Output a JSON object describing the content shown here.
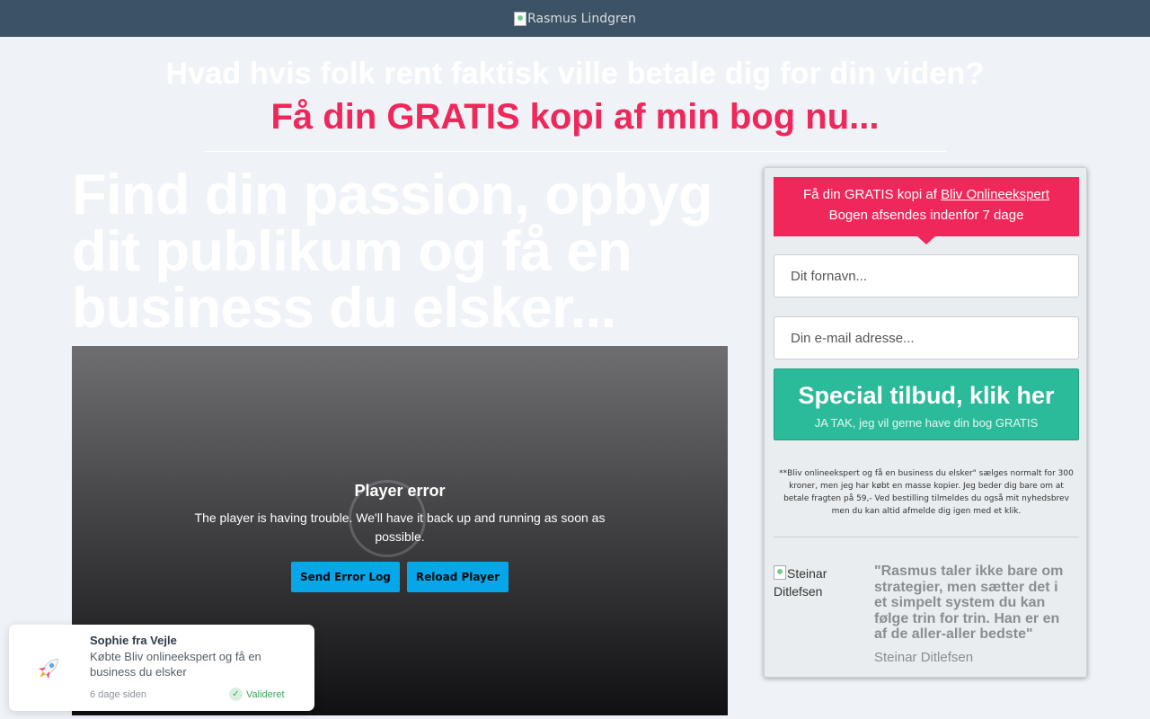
{
  "header": {
    "logo_alt": "Rasmus Lindgren"
  },
  "headline": {
    "question": "Hvad hvis folk rent faktisk ville betale dig for din viden?",
    "offer": "Få din GRATIS kopi af min bog nu..."
  },
  "hero_title": "Find din passion, opbyg dit publikum og få en business du elsker...",
  "player": {
    "error_title": "Player error",
    "error_message": "The player is having trouble. We'll have it back up and running as soon as possible.",
    "send_log_label": "Send Error Log",
    "reload_label": "Reload Player"
  },
  "form": {
    "head_prefix": "Få din GRATIS kopi af ",
    "head_link": "Bliv Onlineekspert",
    "head_line2": "Bogen afsendes indenfor 7 dage",
    "firstname_placeholder": "Dit fornavn...",
    "email_placeholder": "Din e-mail adresse...",
    "cta_main": "Special tilbud, klik her",
    "cta_sub": "JA TAK, jeg vil gerne have din bog GRATIS",
    "disclaimer": "**Bliv onlineekspert og få en business du elsker\" sælges normalt for 300 kroner, men jeg har købt en masse kopier. Jeg beder dig bare om at betale fragten på 59,- Ved bestilling tilmeldes du også mit nyhedsbrev men du kan altid afmelde dig igen med et klik."
  },
  "testimonial": {
    "image_alt": "Steinar Ditlefsen",
    "quote": "\"Rasmus taler ikke bare om strategier, men sætter det i et simpelt system du kan følge trin for trin. Han er en af de aller-aller bedste\"",
    "name": "Steinar Ditlefsen"
  },
  "notification": {
    "name": "Sophie fra Vejle",
    "text": "Købte Bliv onlineekspert og få en business du elsker",
    "time": "6 dage siden",
    "verified": "Valideret",
    "icon": "rocket-icon"
  },
  "colors": {
    "accent_red": "#f0275a",
    "cta_green": "#2bbb9a",
    "topbar": "#3b5364",
    "player_button": "#05a7e9"
  }
}
